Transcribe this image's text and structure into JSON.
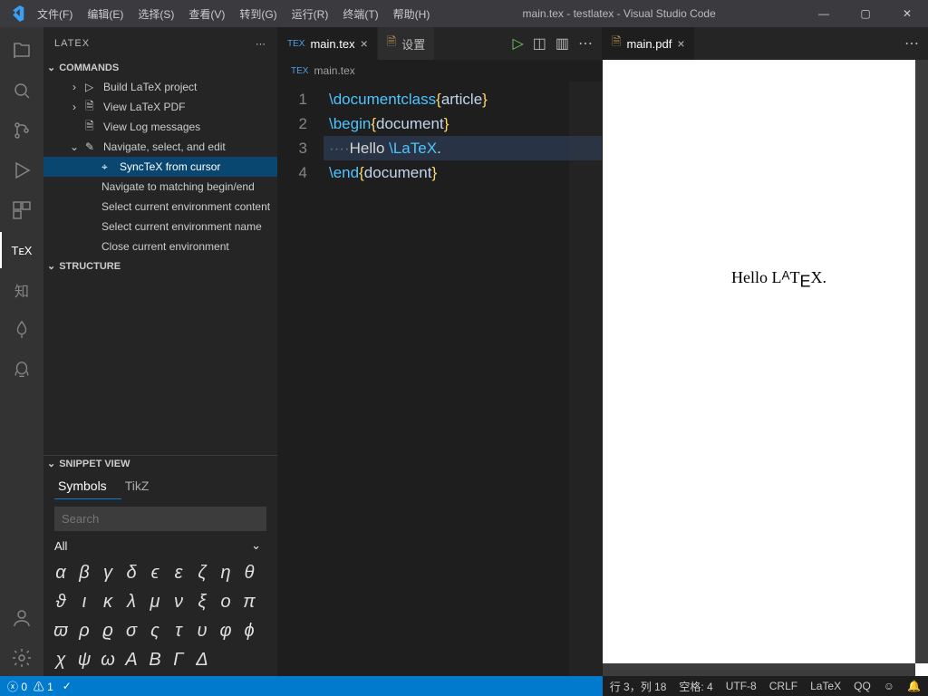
{
  "window": {
    "title": "main.tex - testlatex - Visual Studio Code"
  },
  "menu": [
    "文件(F)",
    "编辑(E)",
    "选择(S)",
    "查看(V)",
    "转到(G)",
    "运行(R)",
    "终端(T)",
    "帮助(H)"
  ],
  "sidebar": {
    "title": "LATEX",
    "sections": {
      "commands": {
        "label": "COMMANDS",
        "items": [
          {
            "label": "Build LaTeX project",
            "depth": 1,
            "twisty": "›",
            "icon": "play"
          },
          {
            "label": "View LaTeX PDF",
            "depth": 1,
            "twisty": "›",
            "icon": "file-pdf"
          },
          {
            "label": "View Log messages",
            "depth": 1,
            "twisty": "",
            "icon": "file"
          },
          {
            "label": "Navigate, select, and edit",
            "depth": 1,
            "twisty": "⌄",
            "icon": "edit"
          },
          {
            "label": "SyncTeX from cursor",
            "depth": 2,
            "selected": true,
            "icon": "cursor"
          },
          {
            "label": "Navigate to matching begin/end",
            "depth": 2
          },
          {
            "label": "Select current environment content",
            "depth": 2
          },
          {
            "label": "Select current environment name",
            "depth": 2
          },
          {
            "label": "Close current environment",
            "depth": 2
          }
        ]
      },
      "structure": {
        "label": "STRUCTURE"
      },
      "snippet": {
        "label": "SNIPPET VIEW",
        "tabs": [
          "Symbols",
          "TikZ"
        ],
        "search_placeholder": "Search",
        "filter": "All",
        "symbols_rows": [
          [
            "α",
            "β",
            "γ",
            "δ",
            "ϵ",
            "ε",
            "ζ",
            "η",
            "θ",
            "ϑ",
            "ι",
            "κ",
            "λ"
          ],
          [
            "μ",
            "ν",
            "ξ",
            "ο",
            "π",
            "ϖ",
            "ρ",
            "ϱ",
            "σ",
            "ς",
            "τ",
            "υ"
          ],
          [
            "φ",
            "ϕ",
            "χ",
            "ψ",
            "ω",
            "A",
            "B",
            "Γ",
            "Δ"
          ]
        ]
      }
    }
  },
  "editor_left": {
    "tabs": [
      {
        "name": "main.tex",
        "icon": "tex",
        "active": true,
        "close": true
      },
      {
        "name": "设置",
        "icon": "file",
        "active": false,
        "close": false
      }
    ],
    "breadcrumb": {
      "icon": "tex",
      "label": "main.tex"
    },
    "lines": [
      {
        "n": "1",
        "segments": [
          {
            "t": "\\documentclass",
            "c": "tok-cmd"
          },
          {
            "t": "{",
            "c": "tok-brace"
          },
          {
            "t": "article",
            "c": "tok-arg"
          },
          {
            "t": "}",
            "c": "tok-brace"
          }
        ]
      },
      {
        "n": "2",
        "segments": [
          {
            "t": "\\begin",
            "c": "tok-cmd"
          },
          {
            "t": "{",
            "c": "tok-brace"
          },
          {
            "t": "document",
            "c": "tok-arg"
          },
          {
            "t": "}",
            "c": "tok-brace"
          }
        ]
      },
      {
        "n": "3",
        "hl": true,
        "segments": [
          {
            "t": "····",
            "c": "tok-dot"
          },
          {
            "t": "Hello ",
            "c": "tok-text"
          },
          {
            "t": "\\LaTeX",
            "c": "tok-cmd"
          },
          {
            "t": ".",
            "c": "tok-text"
          }
        ]
      },
      {
        "n": "4",
        "segments": [
          {
            "t": "\\end",
            "c": "tok-cmd"
          },
          {
            "t": "{",
            "c": "tok-brace"
          },
          {
            "t": "document",
            "c": "tok-arg"
          },
          {
            "t": "}",
            "c": "tok-brace"
          }
        ]
      }
    ]
  },
  "editor_right": {
    "tabs": [
      {
        "name": "main.pdf",
        "icon": "pdf",
        "active": true,
        "close": true
      }
    ],
    "pdf_text": "Hello LᴬTᴇX."
  },
  "status": {
    "left": {
      "errors": "0",
      "warnings": "1"
    },
    "check_icon": "✓",
    "right": [
      "行 3，列 18",
      "空格: 4",
      "UTF-8",
      "CRLF",
      "LaTeX",
      "QQ"
    ],
    "bell": "🔔"
  }
}
